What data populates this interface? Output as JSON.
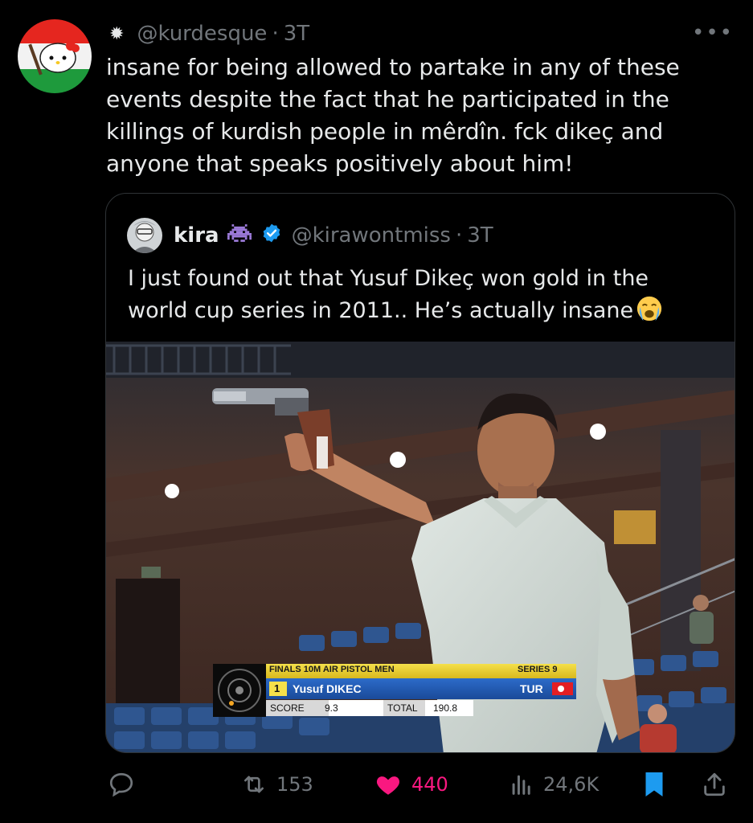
{
  "post": {
    "handle": "@kurdesque",
    "time": "3T",
    "text": "insane for being allowed to partake in any of these events despite the fact that he participated in the killings of kurdish people in mêrdîn. fck dikeç and anyone that speaks positively about him!"
  },
  "quote": {
    "name": "kira",
    "handle": "@kirawontmiss",
    "time": "3T",
    "text": "I just found out that Yusuf Dikeç won gold in the world cup series in 2011.. He’s actually insane",
    "media": {
      "scoreboard": {
        "event": "FINALS 10M AIR PISTOL MEN",
        "series_label": "SERIES",
        "series_value": "9",
        "rank": "1",
        "athlete": "Yusuf DIKEC",
        "country": "TUR",
        "score_label": "SCORE",
        "score_value": "9.3",
        "total_label": "TOTAL",
        "total_value": "190.8"
      }
    }
  },
  "actions": {
    "reposts": "153",
    "likes": "440",
    "views": "24,6K"
  },
  "colors": {
    "background": "#000000",
    "text": "#e7e9ea",
    "muted": "#71767b",
    "like": "#f91880",
    "bookmark": "#1d9bf0",
    "verified": "#1d9bf0"
  }
}
